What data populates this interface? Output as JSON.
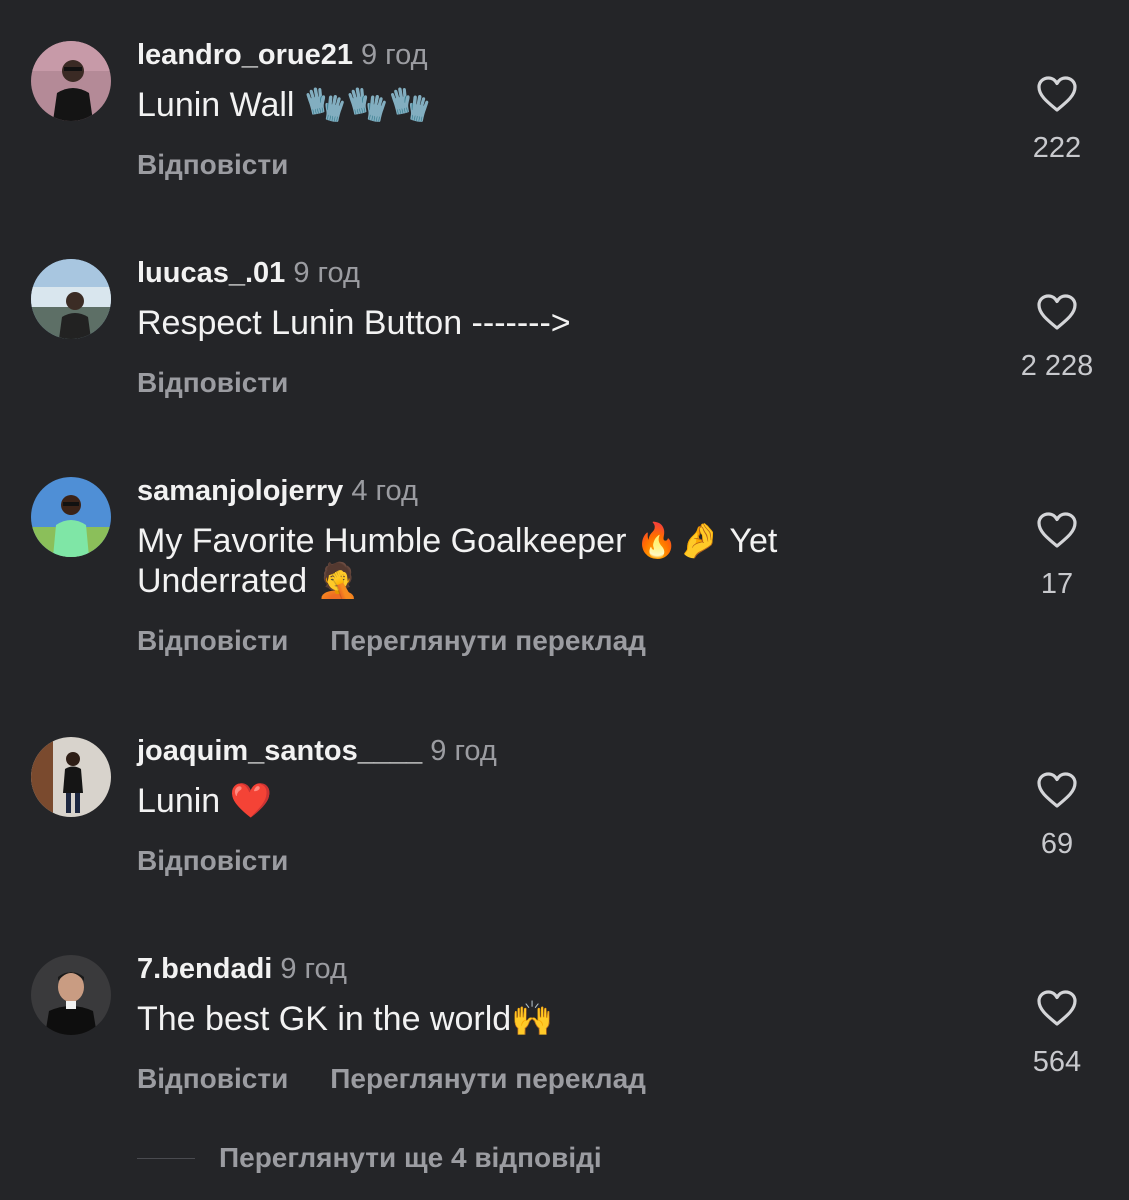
{
  "comments": [
    {
      "username": "leandro_orue21",
      "time": "9 год",
      "text": "Lunin Wall",
      "text2": "",
      "emoji": "🧤🧤🧤",
      "emoji_tail": "",
      "reply_label": "Відповісти",
      "translate_label": "",
      "likes": "222",
      "avatar_icon": "person-avatar-dark-shirt"
    },
    {
      "username": "luucas_.01",
      "time": "9 год",
      "text": "Respect Lunin Button ------->",
      "text2": "",
      "emoji": "",
      "emoji_tail": "",
      "reply_label": "Відповісти",
      "translate_label": "",
      "likes": "2 228",
      "avatar_icon": "person-avatar-waterfall"
    },
    {
      "username": "samanjolojerry",
      "time": "4 год",
      "text": "My Favorite Humble Goalkeeper",
      "emoji": "🔥🤌",
      "text_after": "Yet",
      "text2": "Underrated",
      "emoji_tail": "🤦",
      "reply_label": "Відповісти",
      "translate_label": "Переглянути переклад",
      "likes": "17",
      "avatar_icon": "person-avatar-green-shirt"
    },
    {
      "username": "joaquim_santos____",
      "time": "9 год",
      "text": "Lunin",
      "text2": "",
      "emoji": "❤️",
      "emoji_tail": "",
      "reply_label": "Відповісти",
      "translate_label": "",
      "likes": "69",
      "avatar_icon": "person-avatar-room"
    },
    {
      "username": "7.bendadi",
      "time": "9 год",
      "text": "The best GK in the world",
      "text2": "",
      "emoji": "🙌",
      "emoji_tail": "",
      "reply_label": "Відповісти",
      "translate_label": "Переглянути переклад",
      "likes": "564",
      "avatar_icon": "person-avatar-portrait"
    }
  ],
  "more_replies_label": "Переглянути ще 4 відповіді",
  "colors": {
    "background": "#242528",
    "primary_text": "#f2f2f2",
    "secondary_text": "#9b9ca1",
    "glove_green": "#3fbf73"
  },
  "icons": {
    "like": "heart-outline-icon"
  }
}
